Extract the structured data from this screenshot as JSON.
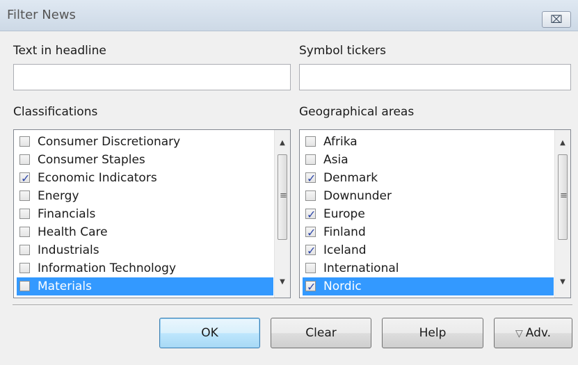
{
  "window": {
    "title": "Filter News",
    "close_glyph": "⌧"
  },
  "headline": {
    "label": "Text in headline",
    "value": ""
  },
  "tickers": {
    "label": "Symbol tickers",
    "value": ""
  },
  "classifications": {
    "label": "Classifications",
    "items": [
      {
        "label": "Consumer Discretionary",
        "checked": false,
        "selected": false
      },
      {
        "label": "Consumer Staples",
        "checked": false,
        "selected": false
      },
      {
        "label": "Economic Indicators",
        "checked": true,
        "selected": false
      },
      {
        "label": "Energy",
        "checked": false,
        "selected": false
      },
      {
        "label": "Financials",
        "checked": false,
        "selected": false
      },
      {
        "label": "Health Care",
        "checked": false,
        "selected": false
      },
      {
        "label": "Industrials",
        "checked": false,
        "selected": false
      },
      {
        "label": "Information Technology",
        "checked": false,
        "selected": false
      },
      {
        "label": "Materials",
        "checked": false,
        "selected": true
      }
    ]
  },
  "geo": {
    "label": "Geographical areas",
    "items": [
      {
        "label": "Afrika",
        "checked": false,
        "selected": false
      },
      {
        "label": "Asia",
        "checked": false,
        "selected": false
      },
      {
        "label": "Denmark",
        "checked": true,
        "selected": false
      },
      {
        "label": "Downunder",
        "checked": false,
        "selected": false
      },
      {
        "label": "Europe",
        "checked": true,
        "selected": false
      },
      {
        "label": "Finland",
        "checked": true,
        "selected": false
      },
      {
        "label": "Iceland",
        "checked": true,
        "selected": false
      },
      {
        "label": "International",
        "checked": false,
        "selected": false
      },
      {
        "label": "Nordic",
        "checked": true,
        "selected": true
      }
    ]
  },
  "buttons": {
    "ok": "OK",
    "clear": "Clear",
    "help": "Help",
    "adv": "Adv.",
    "adv_icon": "▽"
  },
  "scroll_glyphs": {
    "up": "▲",
    "down": "▼",
    "grip": "≡"
  },
  "colors": {
    "selection": "#3399ff",
    "check": "#2d46a8"
  }
}
